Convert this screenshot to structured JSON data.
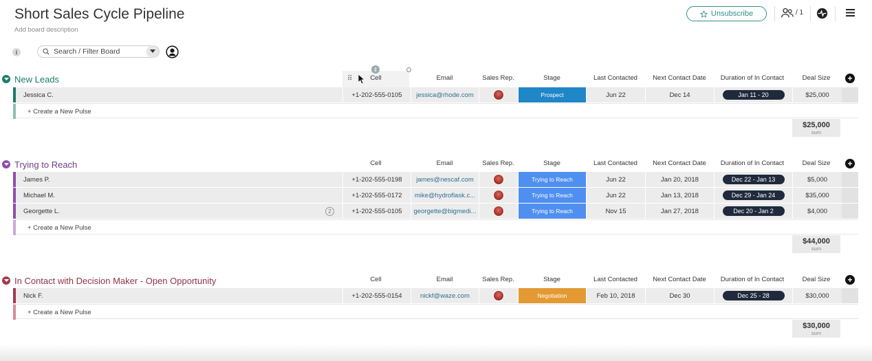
{
  "board": {
    "title": "Short Sales Cycle Pipeline",
    "description": "Add board description",
    "unsubscribe_label": "Unsubscribe",
    "subscribers": "/ 1",
    "search_placeholder": "Search / Filter Board",
    "info_label": "i"
  },
  "columns": {
    "cell": "Cell",
    "email": "Email",
    "sales_rep": "Sales Rep.",
    "stage": "Stage",
    "last_contacted": "Last Contacted",
    "next_contact": "Next Contact Date",
    "duration": "Duration of In Contact",
    "deal_size": "Deal Size"
  },
  "colors": {
    "new_leads": "#1e7b6b",
    "trying": "#8e4ead",
    "in_contact": "#a23a4f",
    "prospect": "#1f86c7",
    "trying_stage": "#4f8ff0",
    "negotiation": "#e39a32"
  },
  "groups": [
    {
      "title": "New Leads",
      "create_label": "+ Create a New Pulse",
      "sum_value": "$25,000",
      "sum_label": "sum",
      "rows": [
        {
          "name": "Jessica C.",
          "cell": "+1-202-555-0105",
          "email": "jessica@rhode.com",
          "stage": "Prospect",
          "last": "Jun 22",
          "next": "Dec 14",
          "duration": "Jan 11 - 20",
          "deal": "$25,000"
        }
      ]
    },
    {
      "title": "Trying to Reach",
      "create_label": "+ Create a New Pulse",
      "sum_value": "$44,000",
      "sum_label": "sum",
      "rows": [
        {
          "name": "James P.",
          "cell": "+1-202-555-0198",
          "email": "james@nescaf.com",
          "stage": "Trying to Reach",
          "last": "Jun 22",
          "next": "Jan 20, 2018",
          "duration": "Dec 22 - Jan 13",
          "deal": "$5,000"
        },
        {
          "name": "Michael M.",
          "cell": "+1-202-555-0172",
          "email": "mike@hydroflask.c...",
          "stage": "Trying to Reach",
          "last": "Jun 22",
          "next": "Jan 13, 2018",
          "duration": "Dec 29 - Jan 24",
          "deal": "$35,000"
        },
        {
          "name": "Georgette L.",
          "badge": "2",
          "cell": "+1-202-555-0105",
          "email": "georgette@bigmedi...",
          "stage": "Trying to Reach",
          "last": "Nov 15",
          "next": "Jan 27, 2018",
          "duration": "Dec 20 - Jan 2",
          "deal": "$4,000"
        }
      ]
    },
    {
      "title": "In Contact with Decision Maker - Open Opportunity",
      "create_label": "+ Create a New Pulse",
      "sum_value": "$30,000",
      "sum_label": "sum",
      "rows": [
        {
          "name": "Nick F.",
          "cell": "+1-202-555-0154",
          "email": "nickf@waze.com",
          "stage": "Negotiation",
          "last": "Feb 10, 2018",
          "next": "Dec 30",
          "duration": "Dec 25 - 28",
          "deal": "$30,000"
        }
      ]
    }
  ]
}
